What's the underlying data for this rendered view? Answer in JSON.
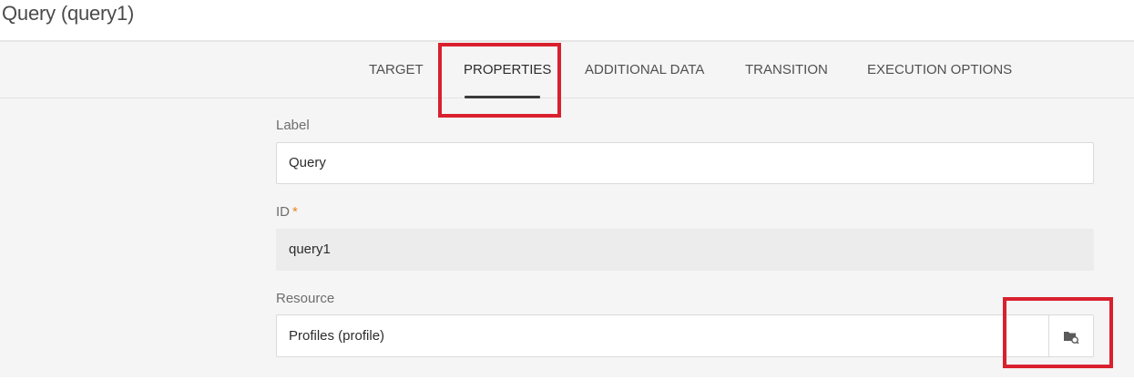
{
  "window": {
    "title": "Query (query1)"
  },
  "tabs": [
    {
      "label": "TARGET"
    },
    {
      "label": "PROPERTIES",
      "active": true
    },
    {
      "label": "ADDITIONAL DATA"
    },
    {
      "label": "TRANSITION"
    },
    {
      "label": "EXECUTION OPTIONS"
    }
  ],
  "form": {
    "label_field": {
      "label": "Label",
      "value": "Query"
    },
    "id_field": {
      "label": "ID",
      "required_marker": "*",
      "value": "query1",
      "readonly": true
    },
    "resource_field": {
      "label": "Resource",
      "value": "Profiles (profile)",
      "button_icon": "folder-search-icon"
    }
  },
  "colors": {
    "highlight": "#d9202e",
    "required": "#e68619",
    "tab_underline": "#3c3c3c"
  }
}
